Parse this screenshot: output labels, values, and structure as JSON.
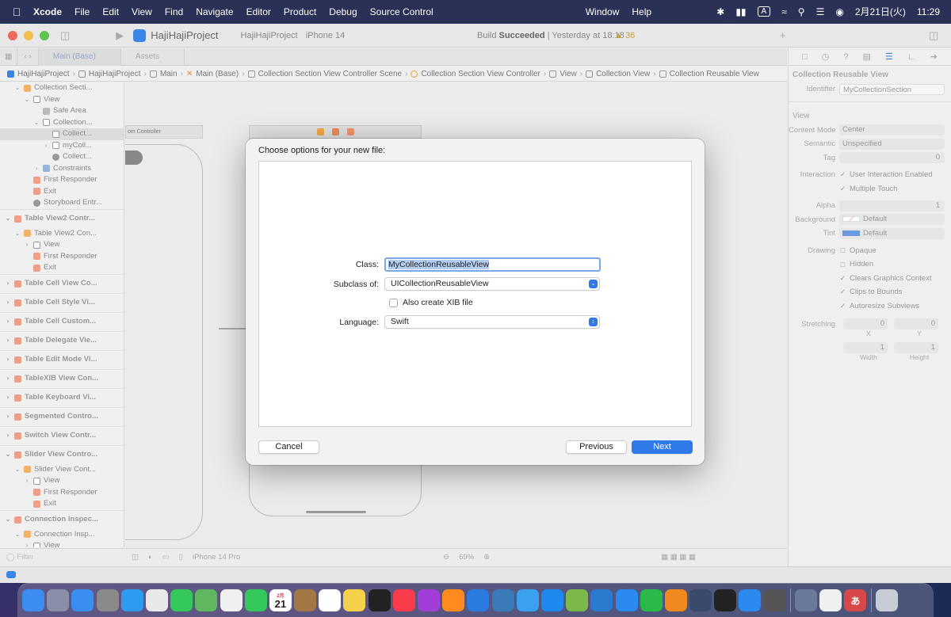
{
  "menubar": {
    "app": "Xcode",
    "items": [
      "File",
      "Edit",
      "View",
      "Find",
      "Navigate",
      "Editor",
      "Product",
      "Debug",
      "Source Control"
    ],
    "window": "Window",
    "help": "Help",
    "ime": "A",
    "date": "2月21日(火)",
    "time": "11:29"
  },
  "toolbar": {
    "project": "HajiHajiProject",
    "scheme": "HajiHajiProject",
    "device": "iPhone 14",
    "build_prefix": "Build",
    "build_status": "Succeeded",
    "build_time": "| Yesterday at 18:18",
    "warnings": "36"
  },
  "tabs": [
    "Main (Base)",
    "Assets"
  ],
  "breadcrumbs": [
    "HajiHajiProject",
    "HajiHajiProject",
    "Main",
    "Main (Base)",
    "Collection Section View Controller Scene",
    "Collection Section View Controller",
    "View",
    "Collection View",
    "Collection Reusable View"
  ],
  "navigator": {
    "rows": [
      {
        "label": "Collection Secti...",
        "indent": 1,
        "icon": "or",
        "tri": "⌄"
      },
      {
        "label": "View",
        "indent": 2,
        "icon": "bx",
        "tri": "⌄"
      },
      {
        "label": "Safe Area",
        "indent": 3,
        "icon": "gr",
        "tri": ""
      },
      {
        "label": "Collection...",
        "indent": 3,
        "icon": "bx",
        "tri": "⌄"
      },
      {
        "label": "Collect...",
        "indent": 4,
        "icon": "bx",
        "tri": "",
        "sel": true
      },
      {
        "label": "myColl...",
        "indent": 4,
        "icon": "bx",
        "tri": "›"
      },
      {
        "label": "Collect...",
        "indent": 4,
        "icon": "ci",
        "tri": ""
      },
      {
        "label": "Constraints",
        "indent": 3,
        "icon": "bl",
        "tri": "›"
      },
      {
        "label": "First Responder",
        "indent": 2,
        "icon": "rd",
        "tri": ""
      },
      {
        "label": "Exit",
        "indent": 2,
        "icon": "rd",
        "tri": ""
      },
      {
        "label": "Storyboard Entr...",
        "indent": 2,
        "icon": "ci",
        "tri": ""
      }
    ],
    "groups": [
      {
        "label": "Table View2 Contr...",
        "open": true,
        "children": [
          {
            "label": "Table View2 Con...",
            "indent": 1,
            "icon": "or",
            "tri": "⌄"
          },
          {
            "label": "View",
            "indent": 2,
            "icon": "bx",
            "tri": "›"
          },
          {
            "label": "First Responder",
            "indent": 2,
            "icon": "rd",
            "tri": ""
          },
          {
            "label": "Exit",
            "indent": 2,
            "icon": "rd",
            "tri": ""
          }
        ]
      },
      {
        "label": "Table Cell View Co...",
        "open": false,
        "children": []
      },
      {
        "label": "Table Cell Style Vi...",
        "open": false,
        "children": []
      },
      {
        "label": "Table Cell Custom...",
        "open": false,
        "children": []
      },
      {
        "label": "Table Delegate Vie...",
        "open": false,
        "children": []
      },
      {
        "label": "Table Edit Mode Vi...",
        "open": false,
        "children": []
      },
      {
        "label": "TableXIB View Con...",
        "open": false,
        "children": []
      },
      {
        "label": "Table Keyboard Vi...",
        "open": false,
        "children": []
      },
      {
        "label": "Segmented Contro...",
        "open": false,
        "children": []
      },
      {
        "label": "Switch View Contr...",
        "open": false,
        "children": []
      },
      {
        "label": "Slider View Contro...",
        "open": true,
        "children": [
          {
            "label": "Slider View Cont...",
            "indent": 1,
            "icon": "or",
            "tri": "⌄"
          },
          {
            "label": "View",
            "indent": 2,
            "icon": "bx",
            "tri": "›"
          },
          {
            "label": "First Responder",
            "indent": 2,
            "icon": "rd",
            "tri": ""
          },
          {
            "label": "Exit",
            "indent": 2,
            "icon": "rd",
            "tri": ""
          }
        ]
      },
      {
        "label": "Connection Inspec...",
        "open": true,
        "children": [
          {
            "label": "Connection Insp...",
            "indent": 1,
            "icon": "or",
            "tri": "⌄"
          },
          {
            "label": "View",
            "indent": 2,
            "icon": "bx",
            "tri": "›"
          }
        ]
      }
    ],
    "filter_placeholder": "Filter"
  },
  "canvas": {
    "scene_label": "om Controller",
    "device": "iPhone 14 Pro",
    "zoom": "69%"
  },
  "inspector": {
    "title": "Collection Reusable View",
    "identifier_label": "Identifier",
    "identifier_value": "MyCollectionSection",
    "view_section": "View",
    "content_mode_label": "Content Mode",
    "content_mode": "Center",
    "semantic_label": "Semantic",
    "semantic": "Unspecified",
    "tag_label": "Tag",
    "tag": "0",
    "interaction_label": "Interaction",
    "user_interaction": "User Interaction Enabled",
    "multiple_touch": "Multiple Touch",
    "alpha_label": "Alpha",
    "alpha": "1",
    "background_label": "Background",
    "background": "Default",
    "tint_label": "Tint",
    "tint": "Default",
    "tint_color": "#6b9ae0",
    "drawing_label": "Drawing",
    "opaque": "Opaque",
    "hidden": "Hidden",
    "clears": "Clears Graphics Context",
    "clips": "Clips to Bounds",
    "autoresize": "Autoresize Subviews",
    "stretching_label": "Stretching",
    "stretch_x": "0",
    "stretch_y": "0",
    "x_label": "X",
    "y_label": "Y",
    "stretch_w": "1",
    "stretch_h": "1",
    "width_label": "Width",
    "height_label": "Height"
  },
  "dialog": {
    "title": "Choose options for your new file:",
    "class_label": "Class:",
    "class_value": "MyCollectionReusableView",
    "subclass_label": "Subclass of:",
    "subclass_value": "UICollectionReusableView",
    "xib_label": "Also create XIB file",
    "language_label": "Language:",
    "language_value": "Swift",
    "cancel": "Cancel",
    "previous": "Previous",
    "next": "Next",
    "accent_color": "#2f7ae8"
  },
  "dock": {
    "calendar_month": "2月",
    "calendar_day": "21",
    "kana": "あ",
    "apps": [
      "finder",
      "launchpad",
      "mail",
      "system-settings",
      "safari",
      "chrome",
      "messages",
      "maps",
      "photos",
      "facetime",
      "calendar",
      "notes-brown",
      "reminders",
      "notes",
      "apple-tv",
      "music",
      "podcasts",
      "books",
      "xcode",
      "instruments",
      "simulator",
      "app-store",
      "script-editor",
      "vscode",
      "keynote",
      "numbers",
      "pages",
      "sf-symbols",
      "terminal",
      "zoom",
      "calculator"
    ]
  }
}
